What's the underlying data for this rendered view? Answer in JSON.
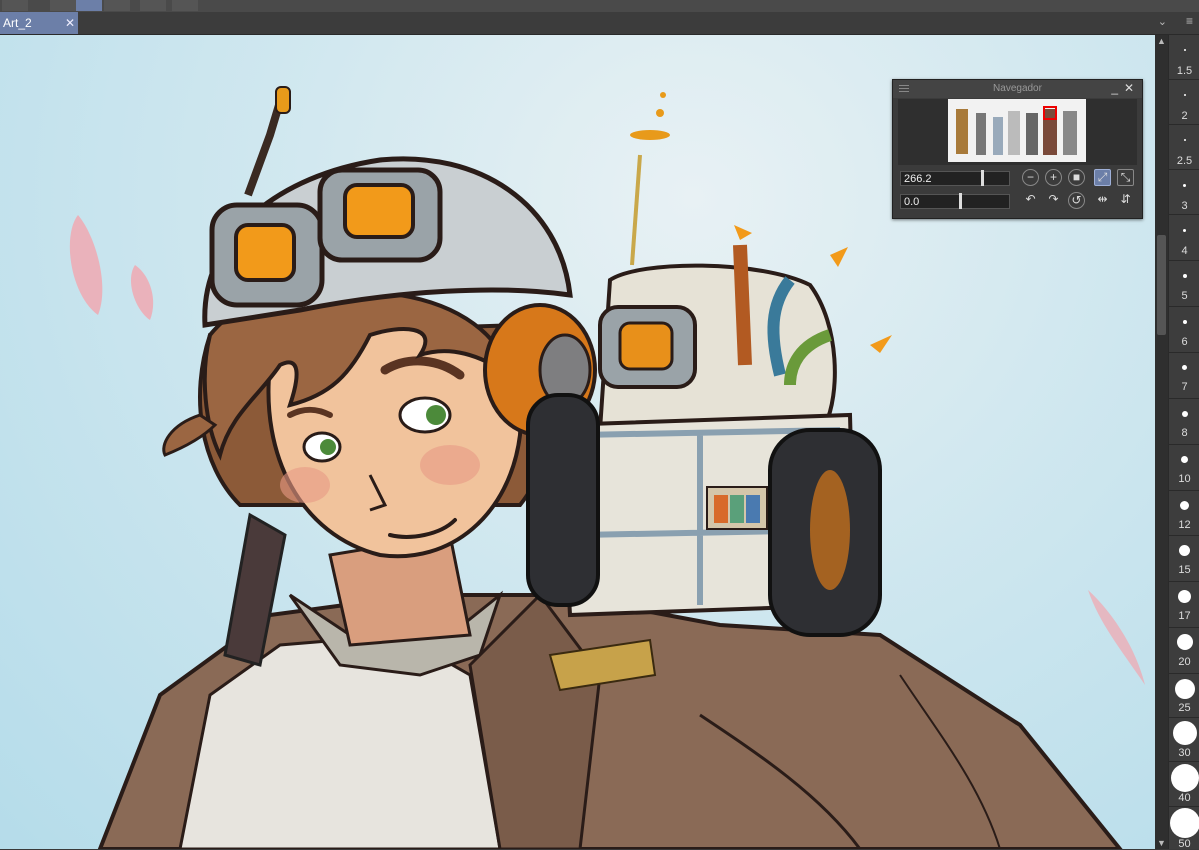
{
  "document_tab": {
    "label": "Art_2",
    "close_symbol": "✕"
  },
  "tab_bar": {
    "scroll_symbol": "⌄",
    "menu_symbol": "≡"
  },
  "navigator": {
    "title": "Navegador",
    "minimize_symbol": "_",
    "close_symbol": "✕",
    "zoom_value": "266.2",
    "rotation_value": "0.0",
    "icons": [
      "zoom-out-icon",
      "zoom-in-icon",
      "actual-size-icon",
      "fit-to-window-icon",
      "fill-window-icon",
      "rotate-left-icon",
      "rotate-right-icon",
      "reset-rotation-icon",
      "flip-horizontal-icon",
      "flip-vertical-icon"
    ]
  },
  "brush_sizes": [
    "1.5",
    "2",
    "2.5",
    "3",
    "4",
    "5",
    "6",
    "7",
    "8",
    "10",
    "12",
    "15",
    "17",
    "20",
    "25",
    "30",
    "40",
    "50"
  ],
  "scrollbar": {
    "up_symbol": "▲",
    "down_symbol": "▼"
  }
}
